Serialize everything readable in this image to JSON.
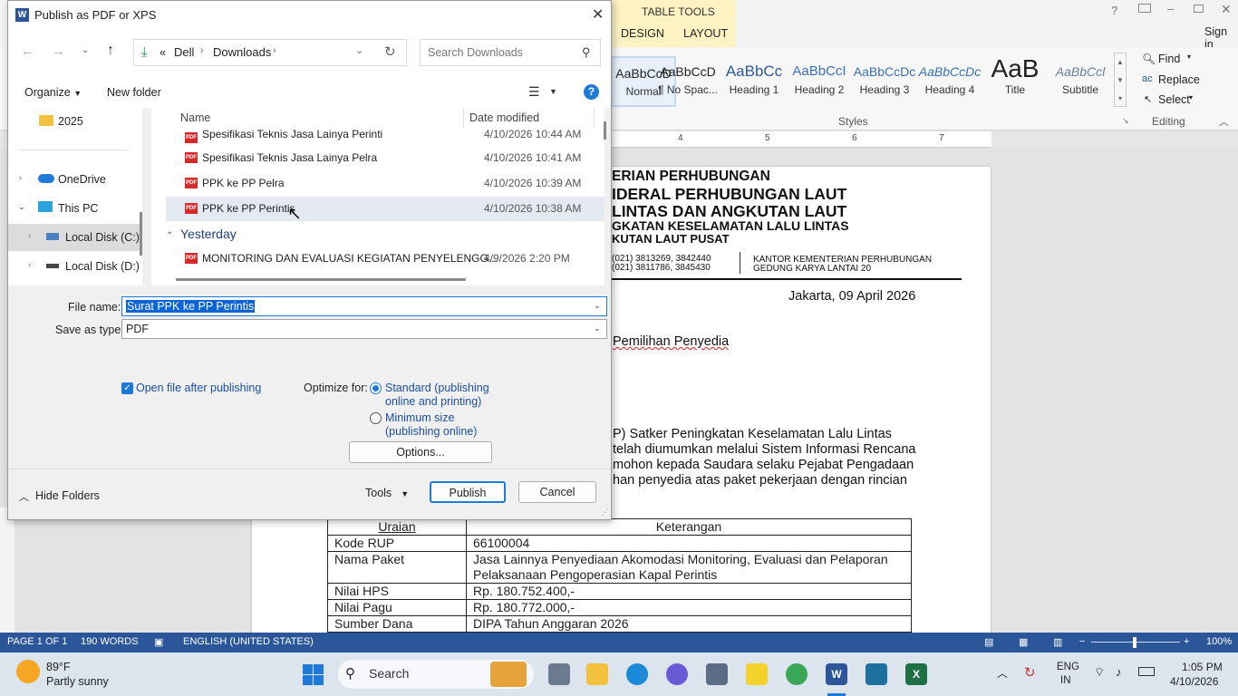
{
  "word": {
    "table_tools": "TABLE TOOLS",
    "tabs": [
      "DESIGN",
      "LAYOUT"
    ],
    "sign_in": "Sign in",
    "styles": [
      {
        "sample": "AaBbCcD",
        "name": "Normal"
      },
      {
        "sample": "AaBbCcD",
        "name": "¶ No Spac..."
      },
      {
        "sample": "AaBbCc",
        "name": "Heading 1"
      },
      {
        "sample": "AaBbCcI",
        "name": "Heading 2"
      },
      {
        "sample": "AaBbCcDc",
        "name": "Heading 3"
      },
      {
        "sample": "AaBbCcDc",
        "name": "Heading 4"
      },
      {
        "sample": "AaB",
        "name": "Title"
      },
      {
        "sample": "AaBbCcl",
        "name": "Subtitle"
      }
    ],
    "styles_group": "Styles",
    "editing": {
      "find": "Find",
      "replace": "Replace",
      "select": "Select",
      "group": "Editing"
    },
    "ruler_marks": [
      "4",
      "5",
      "6",
      "7"
    ],
    "doc": {
      "letterhead_1": "ERIAN PERHUBUNGAN",
      "letterhead_2": "IDERAL PERHUBUNGAN LAUT",
      "letterhead_3": "LINTAS DAN ANGKUTAN LAUT",
      "letterhead_4": "GKATAN KESELAMATAN LALU LINTAS",
      "letterhead_5": "KUTAN LAUT PUSAT",
      "phone_1": "(021) 3813269, 3842440",
      "phone_2": "(021) 3811786, 3845430",
      "office_1": "KANTOR KEMENTERIAN PERHUBUNGAN",
      "office_2": "GEDUNG KARYA LANTAI 20",
      "date": "Jakarta, 09 April 2026",
      "subject": "Pemilihan Penyedia",
      "para_1": "P) Satker Peningkatan Keselamatan Lalu Lintas",
      "para_2": "telah diumumkan melalui Sistem Informasi Rencana",
      "para_3": "mohon kepada Saudara selaku Pejabat Pengadaan",
      "para_4": "han penyedia atas paket pekerjaan dengan rincian"
    },
    "table": {
      "headers": [
        "Uraian",
        "Keterangan"
      ],
      "rows": [
        [
          "Kode RUP",
          "66100004"
        ],
        [
          "Nama Paket",
          "Jasa Lainnya Penyediaan Akomodasi Monitoring, Evaluasi dan Pelaporan Pelaksanaan Pengoperasian Kapal Perintis"
        ],
        [
          "Nilai HPS",
          "Rp. 180.752.400,-"
        ],
        [
          "Nilai Pagu",
          "Rp. 180.772.000,-"
        ],
        [
          "Sumber Dana",
          "DIPA Tahun Anggaran 2026"
        ]
      ]
    },
    "status": {
      "page": "PAGE 1 OF 1",
      "words": "190 WORDS",
      "language": "ENGLISH (UNITED STATES)",
      "zoom": "100%"
    }
  },
  "dialog": {
    "title": "Publish as PDF or XPS",
    "breadcrumb": [
      "«",
      "Dell",
      "Downloads"
    ],
    "search_placeholder": "Search Downloads",
    "organize": "Organize",
    "new_folder": "New folder",
    "nav": [
      {
        "label": "2025"
      },
      {
        "label": "OneDrive"
      },
      {
        "label": "This PC"
      },
      {
        "label": "Local Disk (C:)"
      },
      {
        "label": "Local Disk (D:)"
      }
    ],
    "columns": {
      "name": "Name",
      "date": "Date modified"
    },
    "files": [
      {
        "name": "Spesifikasi Teknis Jasa Lainya Perinti",
        "date": "4/10/2026 10:44 AM"
      },
      {
        "name": "Spesifikasi Teknis Jasa Lainya Pelra",
        "date": "4/10/2026 10:41 AM"
      },
      {
        "name": "PPK ke PP Pelra",
        "date": "4/10/2026 10:39 AM"
      },
      {
        "name": "PPK ke PP Perintis",
        "date": "4/10/2026 10:38 AM"
      }
    ],
    "group_yesterday": "Yesterday",
    "yesterday_files": [
      {
        "name": "MONITORING DAN EVALUASI KEGIATAN PENYELENGG...",
        "date": "4/9/2026 2:20 PM"
      }
    ],
    "file_name_label": "File name:",
    "file_name_value": "Surat PPK ke PP Perintis",
    "save_type_label": "Save as type:",
    "save_type_value": "PDF",
    "open_after": "Open file after publishing",
    "optimize_label": "Optimize for:",
    "opt_standard_1": "Standard (publishing",
    "opt_standard_2": "online and printing)",
    "opt_min_1": "Minimum size",
    "opt_min_2": "(publishing online)",
    "options_btn": "Options...",
    "hide_folders": "Hide Folders",
    "tools": "Tools",
    "publish": "Publish",
    "cancel": "Cancel"
  },
  "taskbar": {
    "temp": "89°F",
    "weather": "Partly sunny",
    "search": "Search",
    "lang_1": "ENG",
    "lang_2": "IN",
    "time": "1:05 PM",
    "date": "4/10/2026"
  }
}
